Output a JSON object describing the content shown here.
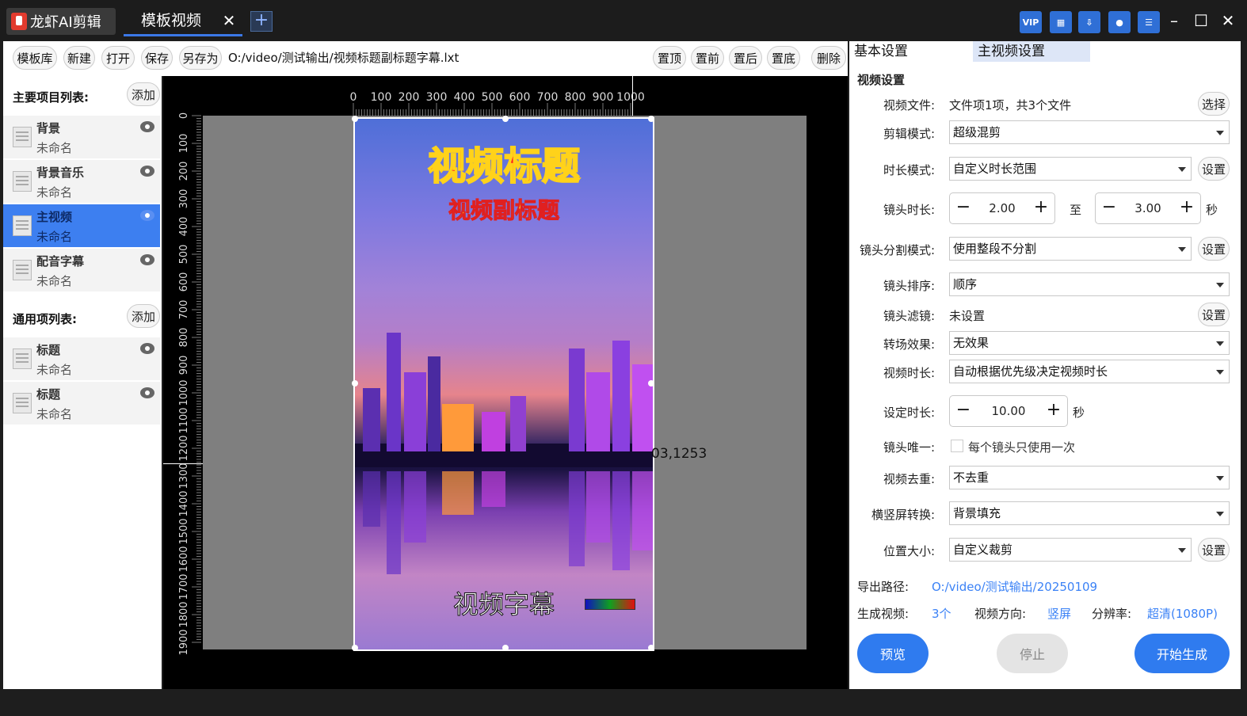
{
  "app": {
    "name": "龙虾AI剪辑",
    "tab": "模板视频"
  },
  "toolbar": {
    "buttons": [
      "模板库",
      "新建",
      "打开",
      "保存",
      "另存为"
    ],
    "filepath": "O:/video/测试输出/视频标题副标题字幕.lxt",
    "right_buttons": [
      "置顶",
      "置前",
      "置后",
      "置底",
      "删除"
    ]
  },
  "left": {
    "main_header": "主要项目列表:",
    "add_label": "添加",
    "main_items": [
      {
        "title": "背景",
        "sub": "未命名"
      },
      {
        "title": "背景音乐",
        "sub": "未命名"
      },
      {
        "title": "主视频",
        "sub": "未命名"
      },
      {
        "title": "配音字幕",
        "sub": "未命名"
      }
    ],
    "common_header": "通用项列表:",
    "common_items": [
      {
        "title": "标题",
        "sub": "未命名"
      },
      {
        "title": "标题",
        "sub": "未命名"
      }
    ]
  },
  "canvas": {
    "h_ticks": [
      "0",
      "100",
      "200",
      "300",
      "400",
      "500",
      "600",
      "700",
      "800",
      "900",
      "1000"
    ],
    "v_ticks": [
      "0",
      "100",
      "200",
      "300",
      "400",
      "500",
      "600",
      "700",
      "800",
      "900",
      "1000",
      "1100",
      "1200",
      "1300",
      "1400",
      "1500",
      "1600",
      "1700",
      "1800",
      "1900"
    ],
    "title": "视频标题",
    "subtitle": "视频副标题",
    "caption": "视频字幕",
    "coord": "03,1253",
    "colors": {
      "title": "#ff2020",
      "subtitle": "#ffd21a"
    }
  },
  "right": {
    "tabs": [
      "基本设置",
      "主视频设置"
    ],
    "section": "视频设置",
    "video_file_label": "视频文件:",
    "video_file_value": "文件项1项，共3个文件",
    "choose": "选择",
    "set": "设置",
    "edit_mode_label": "剪辑模式:",
    "edit_mode": "超级混剪",
    "dur_mode_label": "时长模式:",
    "dur_mode": "自定义时长范围",
    "shot_dur_label": "镜头时长:",
    "shot_min": "2.00",
    "to": "至",
    "shot_max": "3.00",
    "sec": "秒",
    "split_label": "镜头分割模式:",
    "split": "使用整段不分割",
    "order_label": "镜头排序:",
    "order": "顺序",
    "filter_label": "镜头滤镜:",
    "filter": "未设置",
    "trans_label": "转场效果:",
    "trans": "无效果",
    "vdur_label": "视频时长:",
    "vdur": "自动根据优先级决定视频时长",
    "setdur_label": "设定时长:",
    "setdur": "10.00",
    "unique_label": "镜头唯一:",
    "unique": "每个镜头只使用一次",
    "dedup_label": "视频去重:",
    "dedup": "不去重",
    "orient_conv_label": "横竖屏转换:",
    "orient_conv": "背景填充",
    "pos_label": "位置大小:",
    "pos": "自定义裁剪",
    "export_label": "导出路径:",
    "export": "O:/video/测试输出/20250109",
    "gen_label": "生成视频:",
    "gen": "3个",
    "dir_label": "视频方向:",
    "dir": "竖屏",
    "res_label": "分辨率:",
    "res": "超清(1080P)",
    "preview": "预览",
    "stop": "停止",
    "start": "开始生成"
  }
}
